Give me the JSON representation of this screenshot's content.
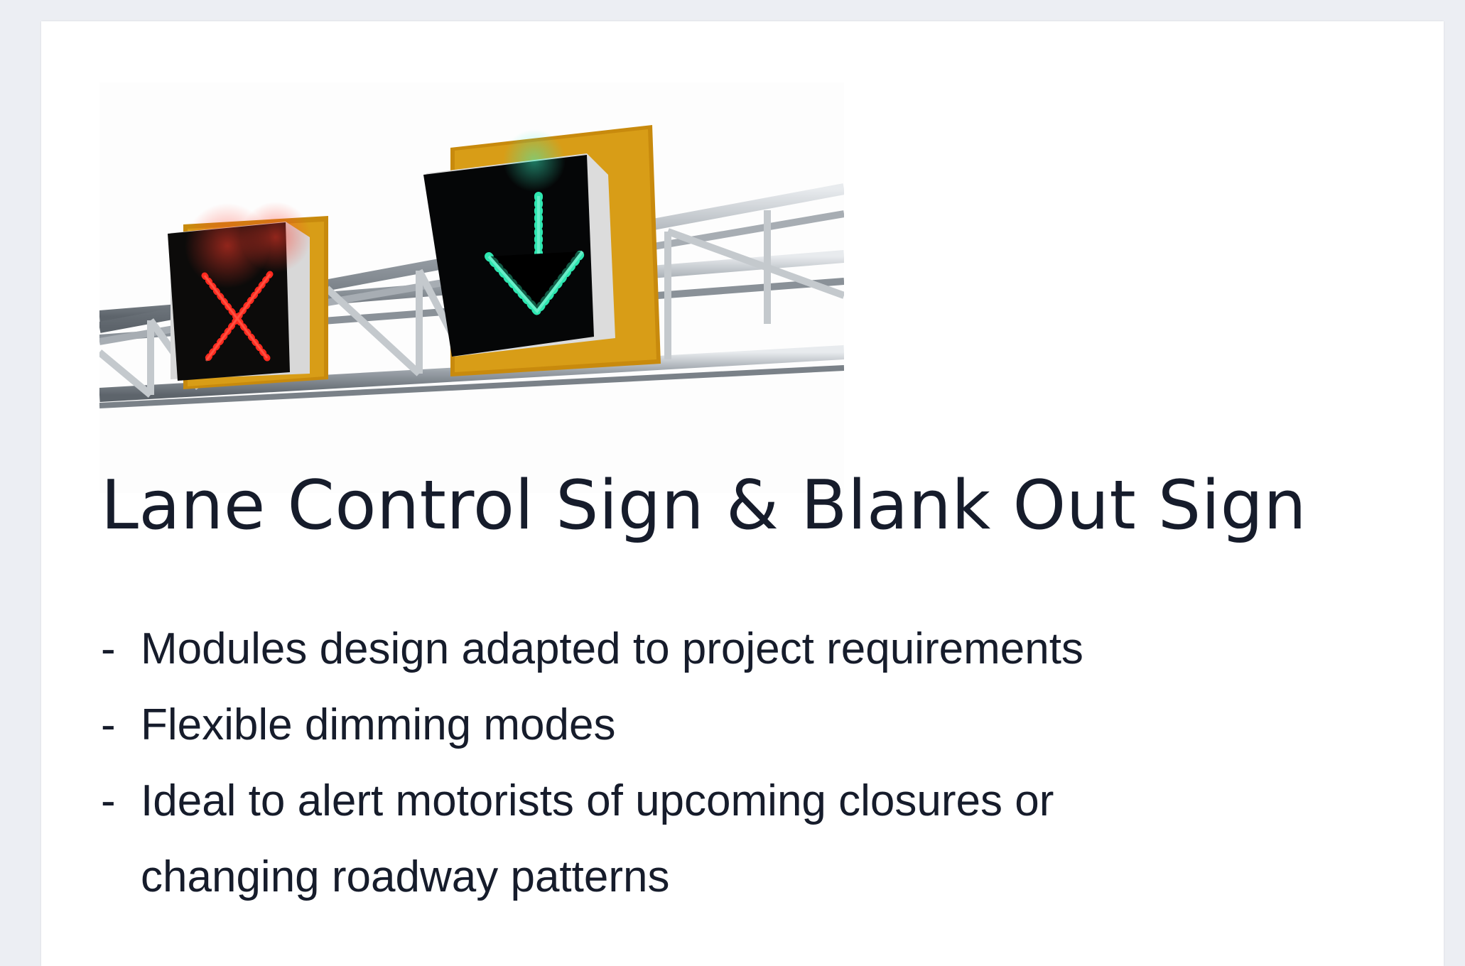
{
  "product": {
    "image": {
      "signs": [
        "red-x-lane-closed",
        "green-down-arrow-lane-open"
      ],
      "colors": {
        "red": "#ff2a1f",
        "green": "#2ee6b0",
        "mount": "#d49a12"
      }
    },
    "title": "Lane Control Sign & Blank Out Sign",
    "bullet_marker": "-",
    "features": [
      "Modules design adapted to project requirements",
      "Flexible dimming modes",
      "Ideal to alert motorists of upcoming closures or changing roadway patterns"
    ]
  },
  "colors": {
    "page_background": "#eceef3",
    "card_background": "#ffffff",
    "text": "#161c2b"
  }
}
